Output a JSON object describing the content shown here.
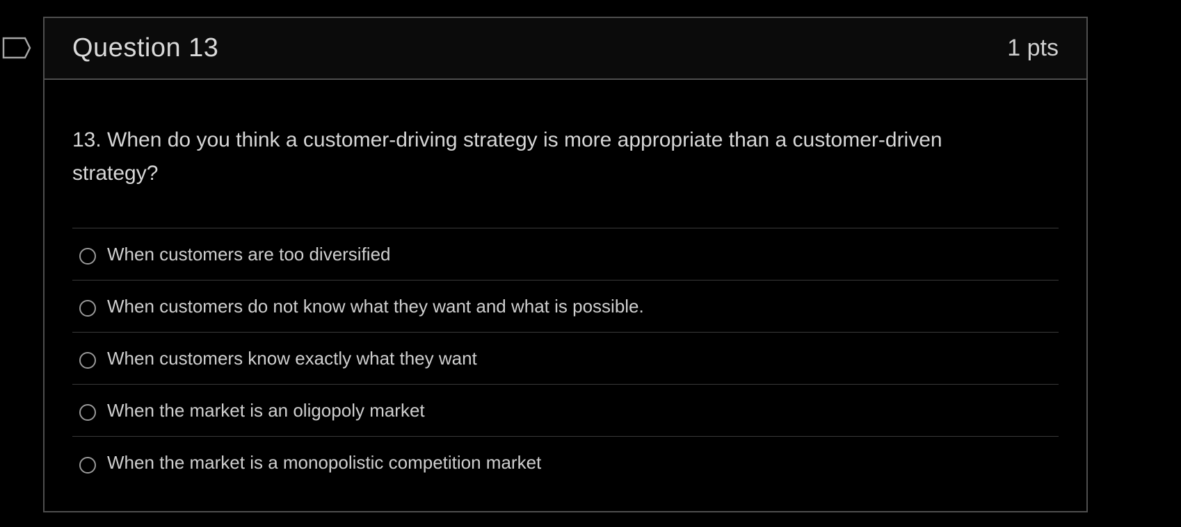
{
  "question": {
    "title": "Question 13",
    "points": "1 pts",
    "text": "13. When do you think  a customer-driving strategy is more appropriate than a customer-driven strategy?",
    "answers": [
      {
        "label": "When customers are too diversified"
      },
      {
        "label": "When customers do not know what they want and what is possible."
      },
      {
        "label": "When customers know exactly what they want"
      },
      {
        "label": "When the market is an oligopoly market"
      },
      {
        "label": "When the market is a monopolistic competition market"
      }
    ]
  },
  "icons": {
    "flag": "bookmark-flag-icon",
    "radio": "radio-unselected-icon"
  },
  "colors": {
    "background": "#000000",
    "border": "#4f4f4f",
    "text": "#d6d6d6"
  }
}
